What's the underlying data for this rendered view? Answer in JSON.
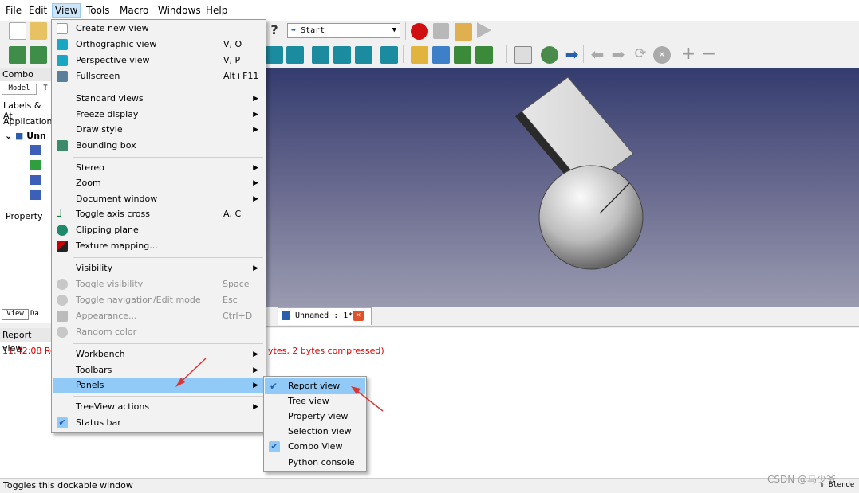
{
  "menubar": {
    "file": "File",
    "edit": "Edit",
    "view": "View",
    "tools": "Tools",
    "macro": "Macro",
    "windows": "Windows",
    "help": "Help"
  },
  "toolbar": {
    "workbench_select": "Start"
  },
  "combo": {
    "title": "Combo View",
    "tab_model": "Model",
    "tab_tasks": "T",
    "labels": "Labels & At",
    "application": "Application",
    "doc_item": "Unn",
    "property": "Property",
    "tab_view": "View",
    "tab_data": "Da"
  },
  "view_menu": {
    "create_new_view": "Create new view",
    "ortho": {
      "label": "Orthographic view",
      "shortcut": "V, O"
    },
    "persp": {
      "label": "Perspective view",
      "shortcut": "V, P"
    },
    "fullscreen": {
      "label": "Fullscreen",
      "shortcut": "Alt+F11"
    },
    "standard_views": "Standard views",
    "freeze": "Freeze display",
    "draw_style": "Draw style",
    "bbox": "Bounding box",
    "stereo": "Stereo",
    "zoom": "Zoom",
    "doc_window": "Document window",
    "axis": {
      "label": "Toggle axis cross",
      "shortcut": "A, C"
    },
    "clipping": "Clipping plane",
    "texture": "Texture mapping...",
    "visibility": "Visibility",
    "toggle_vis": {
      "label": "Toggle visibility",
      "shortcut": "Space"
    },
    "toggle_nav": {
      "label": "Toggle navigation/Edit mode",
      "shortcut": "Esc"
    },
    "appearance": {
      "label": "Appearance...",
      "shortcut": "Ctrl+D"
    },
    "random_color": "Random color",
    "workbench": "Workbench",
    "toolbars": "Toolbars",
    "panels": "Panels",
    "treeview_actions": "TreeView actions",
    "status_bar": "Status bar"
  },
  "panels_menu": {
    "report": "Report view",
    "tree": "Tree view",
    "property": "Property view",
    "selection": "Selection view",
    "combo": "Combo View",
    "python": "Python console"
  },
  "doc_tab": "Unnamed : 1*",
  "report": {
    "title": "Report view",
    "time": "11:42:08",
    "msg_start": "Re",
    "msg_end": "ytes, 2 bytes compressed)"
  },
  "status": "Toggles this dockable window",
  "watermark": "CSDN @马少爷",
  "nav_style": "Blende"
}
